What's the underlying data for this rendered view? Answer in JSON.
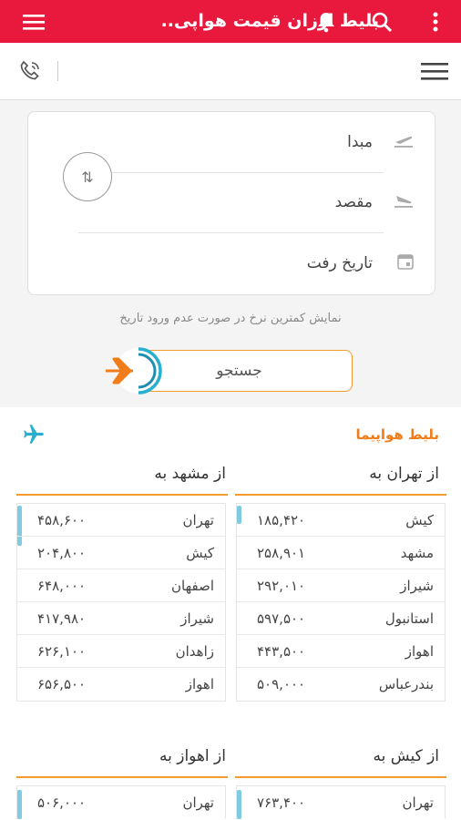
{
  "app": {
    "title": "بلیط ارزان قیمت هواپی..",
    "colors": {
      "primary": "#e8193c",
      "accent": "#f39b2c",
      "brand": "#f07c1a",
      "highlight": "#2ab0cf"
    }
  },
  "search": {
    "origin_label": "مبدا",
    "destination_label": "مقصد",
    "date_label": "تاریخ رفت",
    "swap_icon": "⇅",
    "hint": "نمایش کمترین نرخ در صورت عدم ورود تاریخ",
    "button_label": "جستجو"
  },
  "section": {
    "brand": "بلیط هواپیما"
  },
  "routes": [
    {
      "title": "از تهران به",
      "rows": [
        {
          "city": "کیش",
          "price": "۱۸۵,۴۲۰"
        },
        {
          "city": "مشهد",
          "price": "۲۵۸,۹۰۱"
        },
        {
          "city": "شیراز",
          "price": "۲۹۲,۰۱۰"
        },
        {
          "city": "استانبول",
          "price": "۵۹۷,۵۰۰"
        },
        {
          "city": "اهواز",
          "price": "۴۴۳,۵۰۰"
        },
        {
          "city": "بندرعباس",
          "price": "۵۰۹,۰۰۰"
        }
      ]
    },
    {
      "title": "از مشهد به",
      "rows": [
        {
          "city": "تهران",
          "price": "۴۵۸,۶۰۰"
        },
        {
          "city": "کیش",
          "price": "۲۰۴,۸۰۰"
        },
        {
          "city": "اصفهان",
          "price": "۶۴۸,۰۰۰"
        },
        {
          "city": "شیراز",
          "price": "۴۱۷,۹۸۰"
        },
        {
          "city": "زاهدان",
          "price": "۶۲۶,۱۰۰"
        },
        {
          "city": "اهواز",
          "price": "۶۵۶,۵۰۰"
        }
      ]
    },
    {
      "title": "از کیش به",
      "rows": [
        {
          "city": "تهران",
          "price": "۷۶۳,۴۰۰"
        }
      ]
    },
    {
      "title": "از اهواز به",
      "rows": [
        {
          "city": "تهران",
          "price": "۵۰۶,۰۰۰"
        }
      ]
    }
  ]
}
